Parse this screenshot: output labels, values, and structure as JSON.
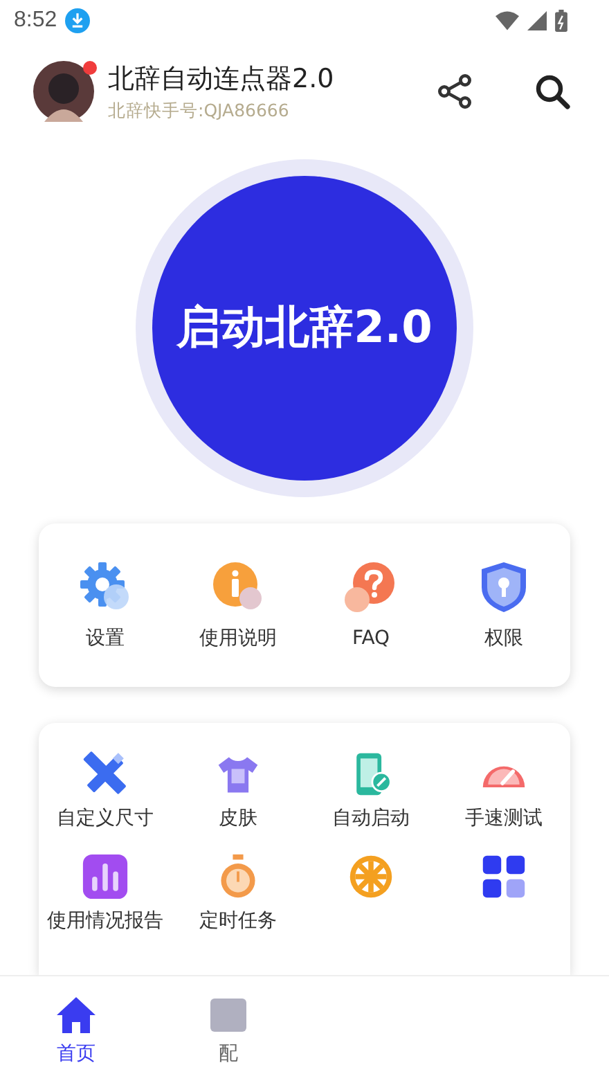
{
  "status_bar": {
    "time": "8:52"
  },
  "header": {
    "title": "北辞自动连点器2.0",
    "subtitle": "北辞快手号:QJA86666",
    "notification_dot": true
  },
  "start_button": {
    "label": "启动北辞2.0"
  },
  "quick_actions": [
    {
      "label": "设置"
    },
    {
      "label": "使用说明"
    },
    {
      "label": "FAQ"
    },
    {
      "label": "权限"
    }
  ],
  "tools": [
    {
      "kind": "labeled",
      "label": "自定义尺寸"
    },
    {
      "kind": "labeled",
      "label": "皮肤"
    },
    {
      "kind": "labeled",
      "label": "自动启动"
    },
    {
      "kind": "labeled",
      "label": "手速测试"
    },
    {
      "kind": "labeled",
      "label": "使用情况报告"
    },
    {
      "kind": "labeled",
      "label": "定时任务"
    },
    {
      "kind": "icon"
    },
    {
      "kind": "icon"
    }
  ],
  "bottom_nav": [
    {
      "label": "首页",
      "selected": true
    },
    {
      "label": "配",
      "selected": false
    }
  ]
}
